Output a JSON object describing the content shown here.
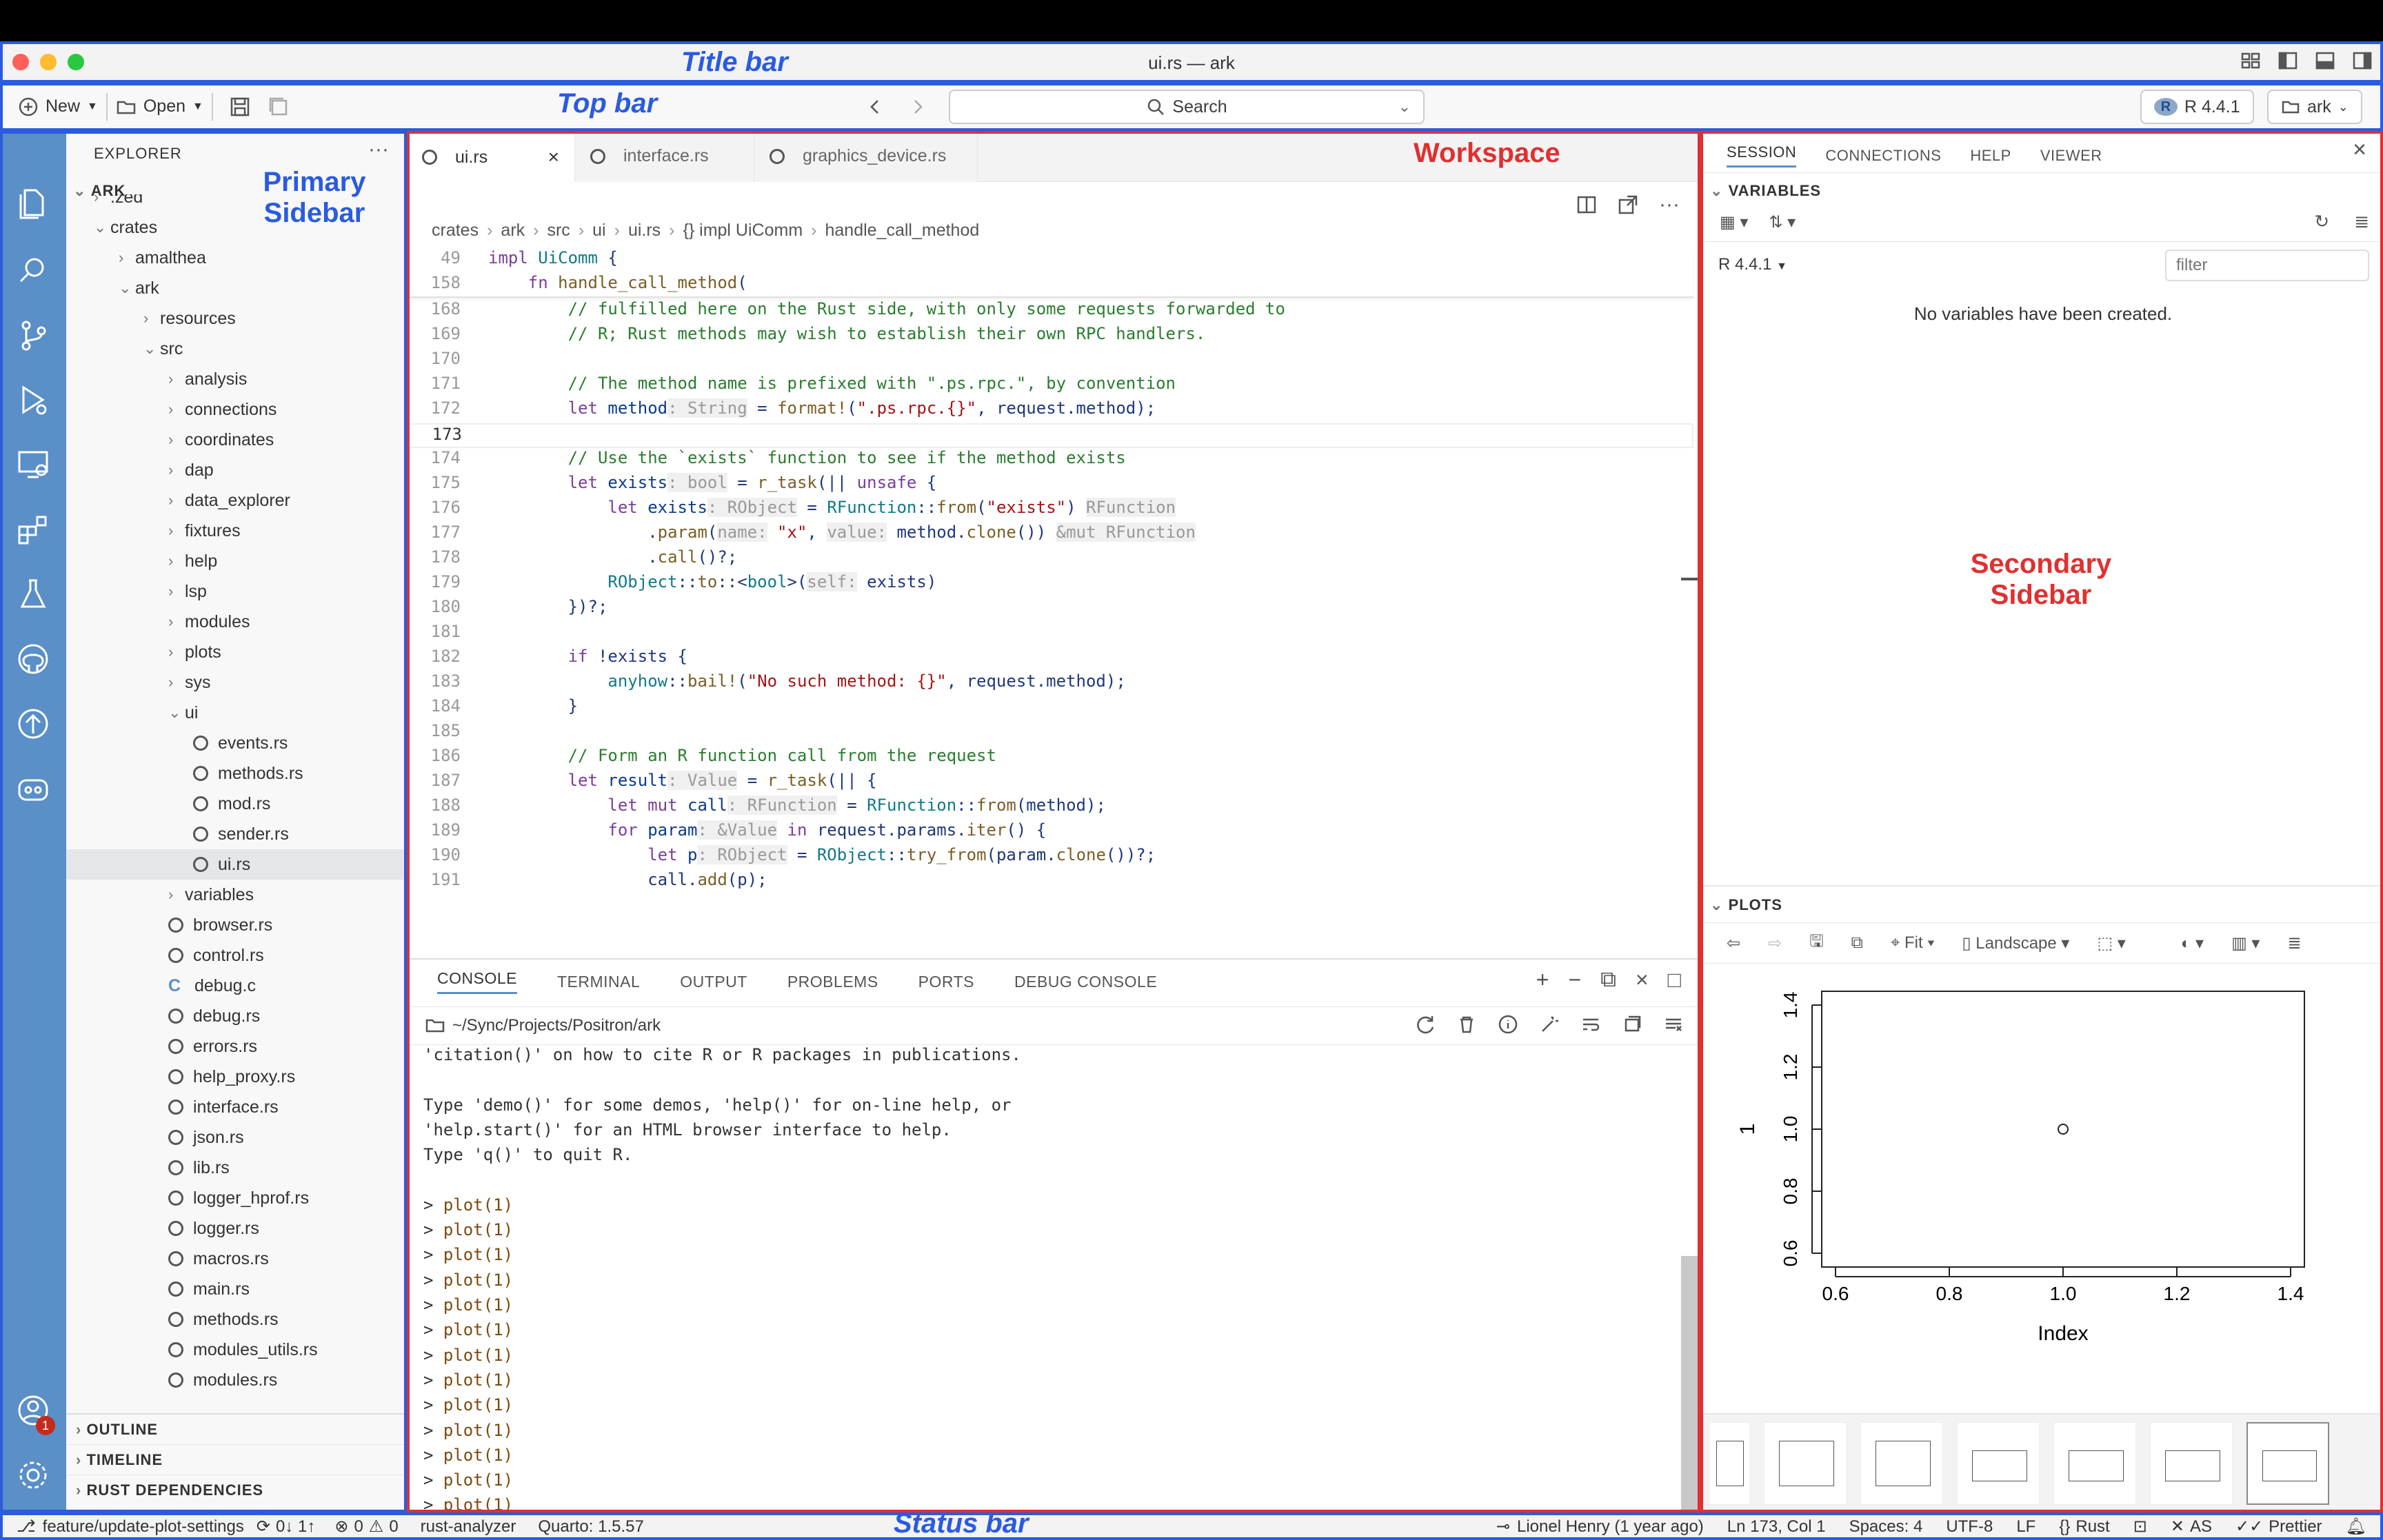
{
  "window": {
    "title": "ui.rs — ark"
  },
  "topbar": {
    "new_label": "New",
    "open_label": "Open",
    "search_label": "Search",
    "r_version": "R 4.4.1",
    "project": "ark"
  },
  "sidebar": {
    "header": "EXPLORER",
    "root": "ARK",
    "items": [
      {
        "label": ".zed",
        "depth": 1,
        "kind": "folder"
      },
      {
        "label": "crates",
        "depth": 1,
        "kind": "folder-open"
      },
      {
        "label": "amalthea",
        "depth": 2,
        "kind": "folder"
      },
      {
        "label": "ark",
        "depth": 2,
        "kind": "folder-open"
      },
      {
        "label": "resources",
        "depth": 3,
        "kind": "folder"
      },
      {
        "label": "src",
        "depth": 3,
        "kind": "folder-open"
      },
      {
        "label": "analysis",
        "depth": 4,
        "kind": "folder"
      },
      {
        "label": "connections",
        "depth": 4,
        "kind": "folder"
      },
      {
        "label": "coordinates",
        "depth": 4,
        "kind": "folder"
      },
      {
        "label": "dap",
        "depth": 4,
        "kind": "folder"
      },
      {
        "label": "data_explorer",
        "depth": 4,
        "kind": "folder"
      },
      {
        "label": "fixtures",
        "depth": 4,
        "kind": "folder"
      },
      {
        "label": "help",
        "depth": 4,
        "kind": "folder"
      },
      {
        "label": "lsp",
        "depth": 4,
        "kind": "folder"
      },
      {
        "label": "modules",
        "depth": 4,
        "kind": "folder"
      },
      {
        "label": "plots",
        "depth": 4,
        "kind": "folder"
      },
      {
        "label": "sys",
        "depth": 4,
        "kind": "folder"
      },
      {
        "label": "ui",
        "depth": 4,
        "kind": "folder-open"
      },
      {
        "label": "events.rs",
        "depth": 5,
        "kind": "rs"
      },
      {
        "label": "methods.rs",
        "depth": 5,
        "kind": "rs"
      },
      {
        "label": "mod.rs",
        "depth": 5,
        "kind": "rs"
      },
      {
        "label": "sender.rs",
        "depth": 5,
        "kind": "rs"
      },
      {
        "label": "ui.rs",
        "depth": 5,
        "kind": "rs",
        "selected": true
      },
      {
        "label": "variables",
        "depth": 4,
        "kind": "folder"
      },
      {
        "label": "browser.rs",
        "depth": 4,
        "kind": "rs"
      },
      {
        "label": "control.rs",
        "depth": 4,
        "kind": "rs"
      },
      {
        "label": "debug.c",
        "depth": 4,
        "kind": "c"
      },
      {
        "label": "debug.rs",
        "depth": 4,
        "kind": "rs"
      },
      {
        "label": "errors.rs",
        "depth": 4,
        "kind": "rs"
      },
      {
        "label": "help_proxy.rs",
        "depth": 4,
        "kind": "rs"
      },
      {
        "label": "interface.rs",
        "depth": 4,
        "kind": "rs"
      },
      {
        "label": "json.rs",
        "depth": 4,
        "kind": "rs"
      },
      {
        "label": "lib.rs",
        "depth": 4,
        "kind": "rs"
      },
      {
        "label": "logger_hprof.rs",
        "depth": 4,
        "kind": "rs"
      },
      {
        "label": "logger.rs",
        "depth": 4,
        "kind": "rs"
      },
      {
        "label": "macros.rs",
        "depth": 4,
        "kind": "rs"
      },
      {
        "label": "main.rs",
        "depth": 4,
        "kind": "rs"
      },
      {
        "label": "methods.rs",
        "depth": 4,
        "kind": "rs"
      },
      {
        "label": "modules_utils.rs",
        "depth": 4,
        "kind": "rs"
      },
      {
        "label": "modules.rs",
        "depth": 4,
        "kind": "rs"
      }
    ],
    "sections": [
      "OUTLINE",
      "TIMELINE",
      "RUST DEPENDENCIES"
    ]
  },
  "editor": {
    "tabs": [
      "ui.rs",
      "interface.rs",
      "graphics_device.rs"
    ],
    "breadcrumb": [
      "crates",
      "ark",
      "src",
      "ui",
      "ui.rs",
      "{} impl UiComm",
      "handle_call_method"
    ],
    "sticky": [
      {
        "n": "49",
        "html": "<span class='kw'>impl</span> <span class='ty'>UiComm</span> {"
      },
      {
        "n": "158",
        "html": "    <span class='kw'>fn</span> <span class='fn'>handle_call_method</span>("
      }
    ],
    "lines": [
      {
        "n": "168",
        "html": "        <span class='cm'>// fulfilled here on the Rust side, with only some requests forwarded to</span>"
      },
      {
        "n": "169",
        "html": "        <span class='cm'>// R; Rust methods may wish to establish their own RPC handlers.</span>"
      },
      {
        "n": "170",
        "html": ""
      },
      {
        "n": "171",
        "html": "        <span class='cm'>// The method name is prefixed with \".ps.rpc.\", by convention</span>"
      },
      {
        "n": "172",
        "html": "        <span class='kw'>let</span> <span class='var'>method</span><span class='hint'>: String</span> = <span class='fn'>format!</span>(<span class='str'>\".ps.rpc.{}\"</span>, request.method);"
      },
      {
        "n": "173",
        "html": ""
      },
      {
        "n": "174",
        "html": "        <span class='cm'>// Use the `exists` function to see if the method exists</span>"
      },
      {
        "n": "175",
        "html": "        <span class='kw'>let</span> <span class='var'>exists</span><span class='hint'>: bool</span> = <span class='fn'>r_task</span>(|| <span class='kw'>unsafe</span> {"
      },
      {
        "n": "176",
        "html": "            <span class='kw'>let</span> <span class='var'>exists</span><span class='hint'>: RObject</span> = <span class='ty'>RFunction</span>::<span class='fn'>from</span>(<span class='str'>\"exists\"</span>) <span class='hint'>RFunction</span>"
      },
      {
        "n": "177",
        "html": "                .<span class='fn'>param</span>(<span class='hint'>name:</span> <span class='str'>\"x\"</span>, <span class='hint'>value:</span> method.<span class='fn'>clone</span>()) <span class='hint'>&amp;mut RFunction</span>"
      },
      {
        "n": "178",
        "html": "                .<span class='fn'>call</span>()?;"
      },
      {
        "n": "179",
        "html": "            <span class='ty'>RObject</span>::<span class='fn'>to</span>::&lt;<span class='ty'>bool</span>&gt;(<span class='hint'>self:</span> exists)"
      },
      {
        "n": "180",
        "html": "        })?;"
      },
      {
        "n": "181",
        "html": ""
      },
      {
        "n": "182",
        "html": "        <span class='kw'>if</span> !exists {"
      },
      {
        "n": "183",
        "html": "            <span class='ty'>anyhow</span>::<span class='fn'>bail!</span>(<span class='str'>\"No such method: {}\"</span>, request.method);"
      },
      {
        "n": "184",
        "html": "        }"
      },
      {
        "n": "185",
        "html": ""
      },
      {
        "n": "186",
        "html": "        <span class='cm'>// Form an R function call from the request</span>"
      },
      {
        "n": "187",
        "html": "        <span class='kw'>let</span> <span class='var'>result</span><span class='hint'>: Value</span> = <span class='fn'>r_task</span>(|| {"
      },
      {
        "n": "188",
        "html": "            <span class='kw'>let mut</span> <span class='var'>call</span><span class='hint'>: RFunction</span> = <span class='ty'>RFunction</span>::<span class='fn'>from</span>(method);"
      },
      {
        "n": "189",
        "html": "            <span class='kw'>for</span> <span class='var'>param</span><span class='hint'>: &amp;Value</span> <span class='kw'>in</span> request.params.<span class='fn'>iter</span>() {"
      },
      {
        "n": "190",
        "html": "                <span class='kw'>let</span> <span class='var'>p</span><span class='hint'>: RObject</span> = <span class='ty'>RObject</span>::<span class='fn'>try_from</span>(param.<span class='fn'>clone</span>())?;"
      },
      {
        "n": "191",
        "html": "                call.<span class='fn'>add</span>(p);"
      }
    ]
  },
  "panel": {
    "tabs": [
      "CONSOLE",
      "TERMINAL",
      "OUTPUT",
      "PROBLEMS",
      "PORTS",
      "DEBUG CONSOLE"
    ],
    "path": "~/Sync/Projects/Positron/ark",
    "lines": [
      "'citation()' on how to cite R or R packages in publications.",
      "",
      "Type 'demo()' for some demos, 'help()' for on-line help, or",
      "'help.start()' for an HTML browser interface to help.",
      "Type 'q()' to quit R.",
      "",
      "> plot(1)",
      "> plot(1)",
      "> plot(1)",
      "> plot(1)",
      "> plot(1)",
      "> plot(1)",
      "> plot(1)",
      "> plot(1)",
      "> plot(1)",
      "> plot(1)",
      "> plot(1)",
      "> plot(1)",
      "> plot(1)",
      ">"
    ]
  },
  "secondary": {
    "tabs": [
      "SESSION",
      "CONNECTIONS",
      "HELP",
      "VIEWER"
    ],
    "variables_header": "VARIABLES",
    "r_version": "R 4.4.1",
    "filter_placeholder": "filter",
    "empty_message": "No variables have been created.",
    "plots_header": "PLOTS",
    "fit_label": "Fit",
    "orientation_label": "Landscape"
  },
  "chart_data": {
    "type": "scatter",
    "x": [
      1.0
    ],
    "y": [
      1.0
    ],
    "xlabel": "Index",
    "ylabel": "1",
    "xlim": [
      0.6,
      1.4
    ],
    "ylim": [
      0.6,
      1.4
    ],
    "xticks": [
      "0.6",
      "0.8",
      "1.0",
      "1.2",
      "1.4"
    ],
    "yticks": [
      "0.6",
      "0.8",
      "1.0",
      "1.2",
      "1.4"
    ]
  },
  "status": {
    "branch": "feature/update-plot-settings",
    "sync": "0↓ 1↑",
    "errors": "0",
    "warnings": "0",
    "analyzer": "rust-analyzer",
    "quarto": "Quarto: 1.5.57",
    "blame": "Lionel Henry (1 year ago)",
    "position": "Ln 173, Col 1",
    "spaces": "Spaces: 4",
    "encoding": "UTF-8",
    "eol": "LF",
    "language": "Rust",
    "as": "AS",
    "prettier": "Prettier",
    "badge": "1"
  },
  "annotations": {
    "title_bar": "Title bar",
    "top_bar": "Top bar",
    "primary_sidebar": "Primary Sidebar",
    "workspace": "Workspace",
    "secondary_sidebar": "Secondary Sidebar",
    "status_bar": "Status bar"
  },
  "colors": {
    "accent": "#5a8fc7",
    "annotation_blue": "#2a5be0",
    "annotation_red": "#e03030"
  }
}
